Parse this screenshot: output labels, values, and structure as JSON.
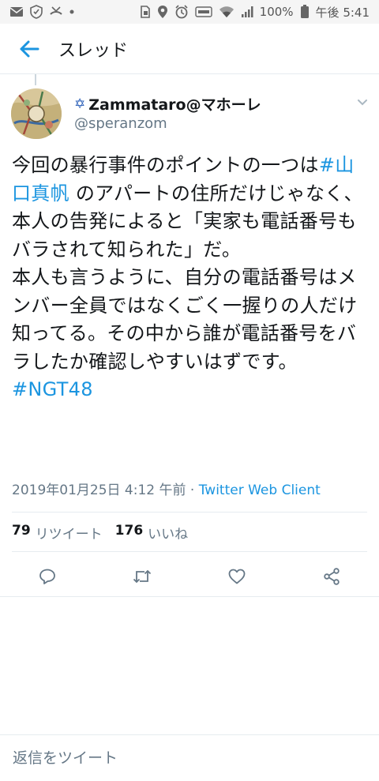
{
  "status_bar": {
    "battery_percent": "100%",
    "time": "午後 5:41",
    "left_icons": [
      "mail-icon",
      "shield-icon",
      "missed-call-icon",
      "dot-icon"
    ],
    "right_icons": [
      "sim-icon",
      "location-icon",
      "alarm-icon",
      "volte-icon",
      "wifi-icon",
      "signal-icon",
      "battery-icon"
    ]
  },
  "header": {
    "title": "スレッド",
    "back_icon": "arrow-left-icon"
  },
  "tweet": {
    "author": {
      "emoji": "✡",
      "display_name": "Zammataro@マホーレ",
      "handle": "@speranzom"
    },
    "body": {
      "t1": "今回の暴行事件のポイントの一つは",
      "hashtag1": "#山口真帆",
      "t2": " のアパートの住所だけじゃなく、本人の告発によると「実家も電話番号もバラされて知られた」だ。",
      "t3": "本人も言うように、自分の電話番号はメンバー全員ではなくごく一握りの人だけ知ってる。その中から誰が電話番号をバラしたか確認しやすいはずです。",
      "hashtag2": "#NGT48"
    },
    "meta": {
      "timestamp": "2019年01月25日 4:12 午前",
      "separator": " · ",
      "client": "Twitter Web Client"
    },
    "stats": {
      "retweets_count": "79",
      "retweets_label": "リツイート",
      "likes_count": "176",
      "likes_label": "いいね"
    }
  },
  "actions": [
    "reply-icon",
    "retweet-icon",
    "like-icon",
    "share-icon"
  ],
  "reply": {
    "placeholder": "返信をツイート"
  },
  "colors": {
    "accent": "#1b95e0",
    "text": "#14171a",
    "secondary": "#657786",
    "divider": "#e6ecf0"
  }
}
